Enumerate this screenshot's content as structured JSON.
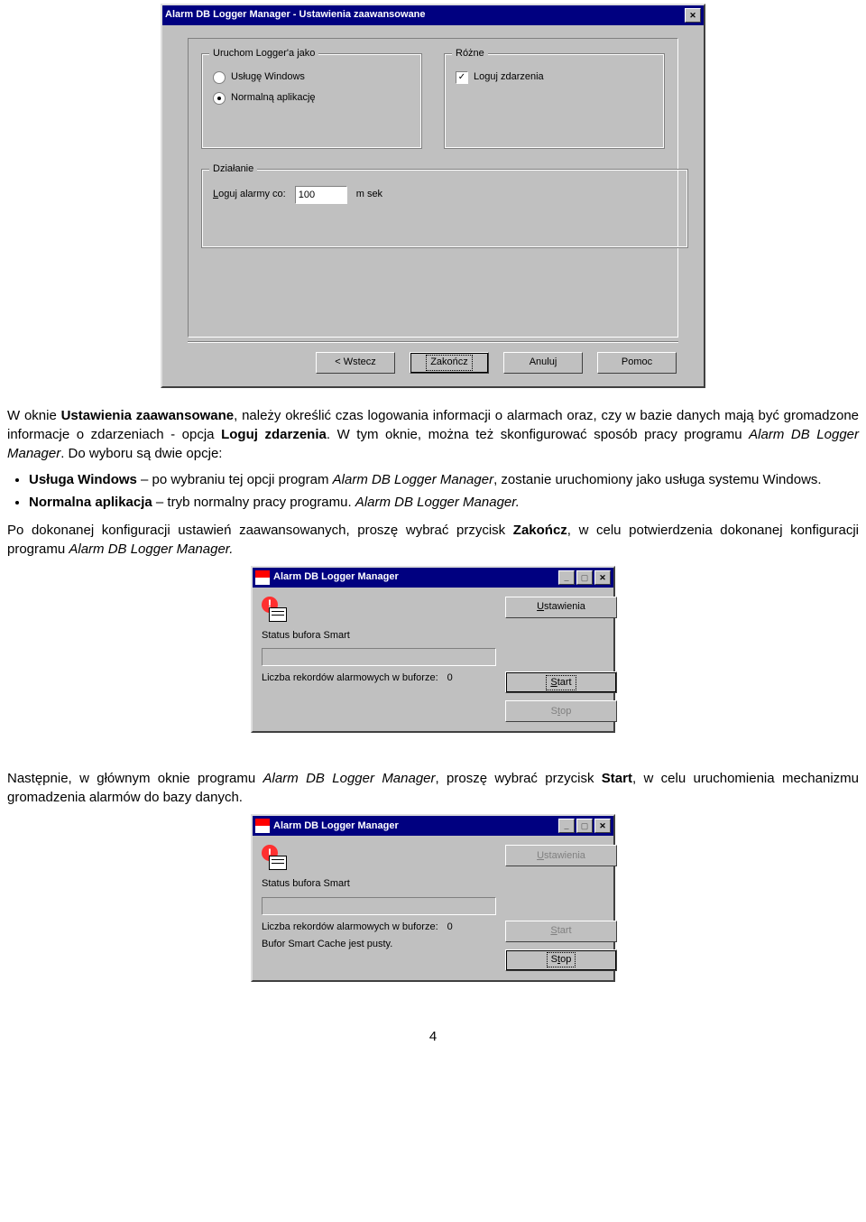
{
  "dialog1": {
    "title": "Alarm DB Logger Manager - Ustawienia zaawansowane",
    "group_run_legend": "Uruchom Logger'a jako",
    "radio_service": "Usługę Windows",
    "radio_app": "Normalną aplikację",
    "group_misc_legend": "Różne",
    "checkbox_log_events": "Loguj zdarzenia",
    "group_action_legend": "Działanie",
    "log_every_label": "Loguj alarmy co:",
    "log_every_value": "100",
    "log_every_unit": "m sek",
    "buttons": {
      "back": "< Wstecz",
      "finish": "Zakończ",
      "cancel": "Anuluj",
      "help": "Pomoc"
    }
  },
  "para1": {
    "pre": "W oknie ",
    "b1": "Ustawienia zaawansowane",
    "mid": ", należy określić czas logowania informacji o alarmach oraz, czy w bazie danych mają być gromadzone informacje o zdarzeniach - opcja ",
    "b2": "Loguj zdarzenia",
    "post1": ". W tym oknie, można też skonfigurować sposób pracy programu ",
    "i1": "Alarm DB Logger Manager",
    "post2": ". Do wyboru są dwie opcje:"
  },
  "bullet1": {
    "b": "Usługa Windows",
    "mid": " – po wybraniu tej opcji program ",
    "i": "Alarm DB Logger Manager",
    "post": ", zostanie uruchomiony jako usługa systemu Windows."
  },
  "bullet2": {
    "b": "Normalna aplikacja",
    "mid": " – tryb normalny pracy programu. ",
    "i": "Alarm DB Logger Manager."
  },
  "para2": {
    "pre": "Po dokonanej konfiguracji ustawień zaawansowanych, proszę wybrać przycisk ",
    "b": "Zakończ",
    "mid": ", w celu potwierdzenia dokonanej konfiguracji programu ",
    "i": "Alarm DB Logger Manager."
  },
  "dialog2": {
    "title": "Alarm DB Logger Manager",
    "settings_btn": "Ustawienia",
    "status_label": "Status bufora Smart",
    "records_label": "Liczba rekordów alarmowych w buforze:",
    "records_value": "0",
    "start_btn": "Start",
    "stop_btn": "Stop"
  },
  "para3": {
    "pre": "Następnie, w głównym oknie programu ",
    "i": "Alarm DB Logger Manager",
    "mid": ", proszę wybrać przycisk ",
    "b": "Start",
    "post": ", w celu uruchomienia mechanizmu gromadzenia alarmów do bazy danych."
  },
  "dialog3": {
    "title": "Alarm DB Logger Manager",
    "settings_btn": "Ustawienia",
    "status_label": "Status bufora Smart",
    "records_label": "Liczba rekordów alarmowych w buforze:",
    "records_value": "0",
    "empty_line": "Bufor Smart Cache jest pusty.",
    "start_btn": "Start",
    "stop_btn": "Stop"
  },
  "page_number": "4"
}
